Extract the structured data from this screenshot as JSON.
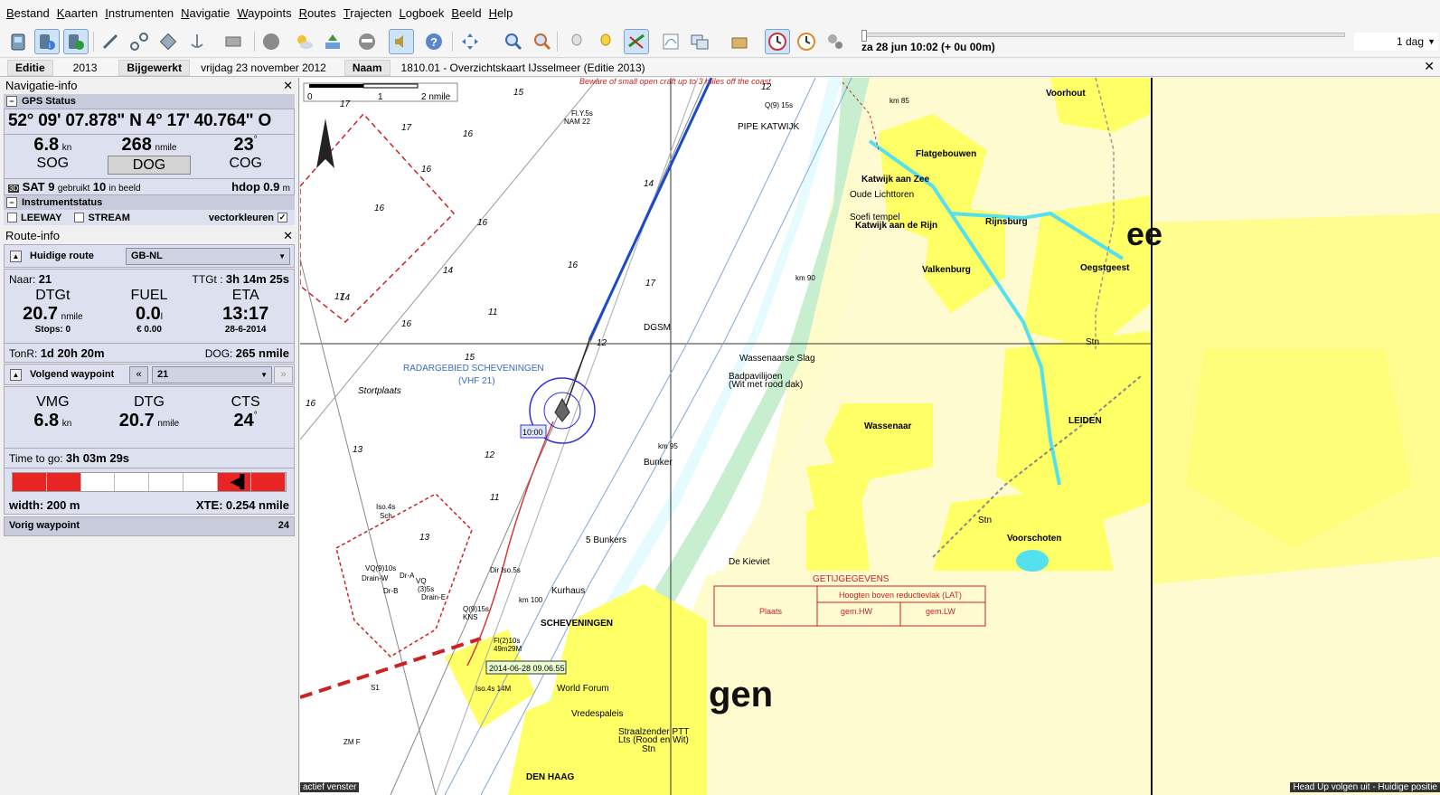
{
  "menu": [
    "Bestand",
    "Kaarten",
    "Instrumenten",
    "Navigatie",
    "Waypoints",
    "Routes",
    "Trajecten",
    "Logboek",
    "Beeld",
    "Help"
  ],
  "time": {
    "label": "za 28 jun 10:02  (+ 0u 00m)",
    "period": "1 dag"
  },
  "chartinfo": {
    "editie_label": "Editie",
    "editie_val": "2013",
    "bijgewerkt_label": "Bijgewerkt",
    "bijgewerkt_val": "vrijdag 23 november 2012",
    "naam_label": "Naam",
    "naam_val": "1810.01 - Overzichtskaart IJsselmeer (Editie 2013)"
  },
  "nav": {
    "title": "Navigatie-info",
    "gps_status": "GPS Status",
    "coord": "52° 09' 07.878\" N   4° 17' 40.764\" O",
    "sog_val": "6.8",
    "sog_unit": "kn",
    "sog_lbl": "SOG",
    "dog_val": "268",
    "dog_unit": "nmile",
    "dog_lbl": "DOG",
    "cog_val": "23",
    "cog_unit": "°",
    "cog_lbl": "COG",
    "sat_label": "SAT 9",
    "sat_used": "gebruikt",
    "sat_in": "10",
    "sat_in_lbl": "in beeld",
    "hdop_label": "hdop",
    "hdop_val": "0.9",
    "hdop_unit": "m",
    "instr": "Instrumentstatus",
    "leeway": "LEEWAY",
    "stream": "STREAM",
    "vector": "vectorkleuren"
  },
  "route": {
    "title": "Route-info",
    "current_label": "Huidige route",
    "current_val": "GB-NL",
    "naar_label": "Naar:",
    "naar_val": "21",
    "ttgt_label": "TTGt :",
    "ttgt_val": "3h 14m 25s",
    "dtgt_lbl": "DTGt",
    "dtgt_val": "20.7",
    "dtgt_unit": "nmile",
    "stops": "Stops: 0",
    "fuel_lbl": "FUEL",
    "fuel_val": "0.0",
    "fuel_unit": "l",
    "fuel_cost": "€ 0.00",
    "eta_lbl": "ETA",
    "eta_val": "13:17",
    "eta_date": "28-6-2014",
    "tonr_label": "TonR:",
    "tonr_val": "1d 20h 20m",
    "dog_label": "DOG:",
    "dog_val": "265 nmile",
    "next_label": "Volgend waypoint",
    "next_val": "21",
    "vmg_lbl": "VMG",
    "vmg_val": "6.8",
    "vmg_unit": "kn",
    "dtg_lbl": "DTG",
    "dtg_val": "20.7",
    "dtg_unit": "nmile",
    "cts_lbl": "CTS",
    "cts_val": "24",
    "cts_unit": "°",
    "ttg_label": "Time to go:",
    "ttg_val": "3h 03m 29s",
    "width_label": "width:",
    "width_val": "200 m",
    "xte_label": "XTE:",
    "xte_val": "0.254 nmile",
    "prev_label": "Vorig waypoint",
    "prev_val": "24"
  },
  "map": {
    "warning": "Beware of small open craft up to 3 miles off the coast",
    "scale_0": "0",
    "scale_1": "1",
    "scale_2": "2 nmile",
    "radar": "RADARGEBIED SCHEVENINGEN",
    "radar_vhf": "(VHF 21)",
    "stortplaats": "Stortplaats",
    "towns": [
      "Voorhout",
      "Flatgebouwen",
      "Katwijk aan Zee",
      "Oude Lichttoren",
      "Soefi tempel",
      "Katwijk aan de Rijn",
      "Rijnsburg",
      "Valkenburg",
      "Oegstgeest",
      "Wassenaarse Slag",
      "Badpavilijoen",
      "(Wit met rood dak)",
      "Wassenaar",
      "LEIDEN",
      "Voorschoten",
      "De Kieviet",
      "Kurhaus",
      "SCHEVENINGEN",
      "World Forum",
      "Vredespaleis",
      "Straalzender PTT",
      "Lts (Rood en Wit)",
      "DEN HAAG",
      "Bunker",
      "5 Bunkers",
      "DGSM",
      "PIPE KATWIJK",
      "Stn",
      "Stn",
      "Stn"
    ],
    "tide_title": "GETIJGEGEVENS",
    "tide_header": "Hoogten boven reductievlak (LAT)",
    "tide_plaats": "Plaats",
    "tide_hw": "gem.HW",
    "tide_lw": "gem.LW",
    "big_gen": "gen",
    "big_ee": "ee",
    "vessel_time": "10:00",
    "track_label": "2014-06-28 09.06.55",
    "lights": [
      "Fl.Y.5s",
      "NAM 22",
      "Q(9) 15s",
      "Iso.4s",
      "Sch",
      "VQ(9)10s",
      "Drain-W",
      "Dr-A",
      "VQ",
      "(3)5s",
      "Drain-E",
      "Dr-B",
      "Q(9)15s",
      "KNS",
      "Dir Iso.5s",
      "Fl(2)10s",
      "49m29M",
      "Iso.4s 14M",
      "ZM F",
      "S1"
    ],
    "km": [
      "km 85",
      "km 90",
      "km 95",
      "km 100"
    ],
    "depths": [
      "15",
      "17",
      "17",
      "16",
      "16",
      "16",
      "16",
      "14",
      "14",
      "16",
      "17",
      "16",
      "17",
      "11",
      "12",
      "15",
      "16",
      "12",
      "13",
      "11",
      "12",
      "14",
      "13"
    ]
  },
  "status": {
    "left": "actief venster",
    "right": "Head Up volgen uit - Huidige positie"
  }
}
